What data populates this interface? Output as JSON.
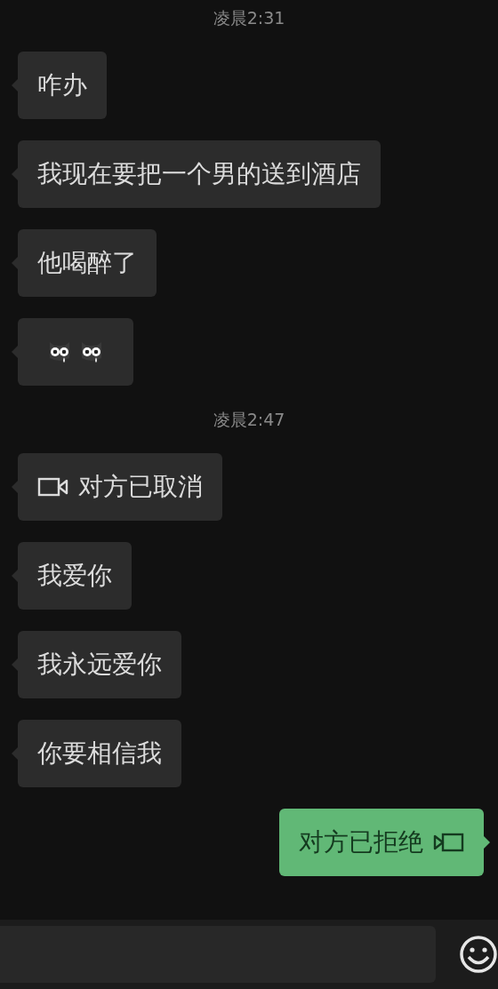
{
  "messages": [
    {
      "kind": "time",
      "text": "凌晨2:31"
    },
    {
      "kind": "text",
      "outgoing": false,
      "text": "咋办"
    },
    {
      "kind": "text",
      "outgoing": false,
      "text": "我现在要把一个男的送到酒店"
    },
    {
      "kind": "text",
      "outgoing": false,
      "text": "他喝醉了"
    },
    {
      "kind": "emoji",
      "outgoing": false
    },
    {
      "kind": "time",
      "text": "凌晨2:47"
    },
    {
      "kind": "call",
      "outgoing": false,
      "text": "对方已取消"
    },
    {
      "kind": "text",
      "outgoing": false,
      "text": "我爱你"
    },
    {
      "kind": "text",
      "outgoing": false,
      "text": "我永远爱你"
    },
    {
      "kind": "text",
      "outgoing": false,
      "text": "你要相信我"
    },
    {
      "kind": "call",
      "outgoing": true,
      "text": "对方已拒绝"
    }
  ]
}
